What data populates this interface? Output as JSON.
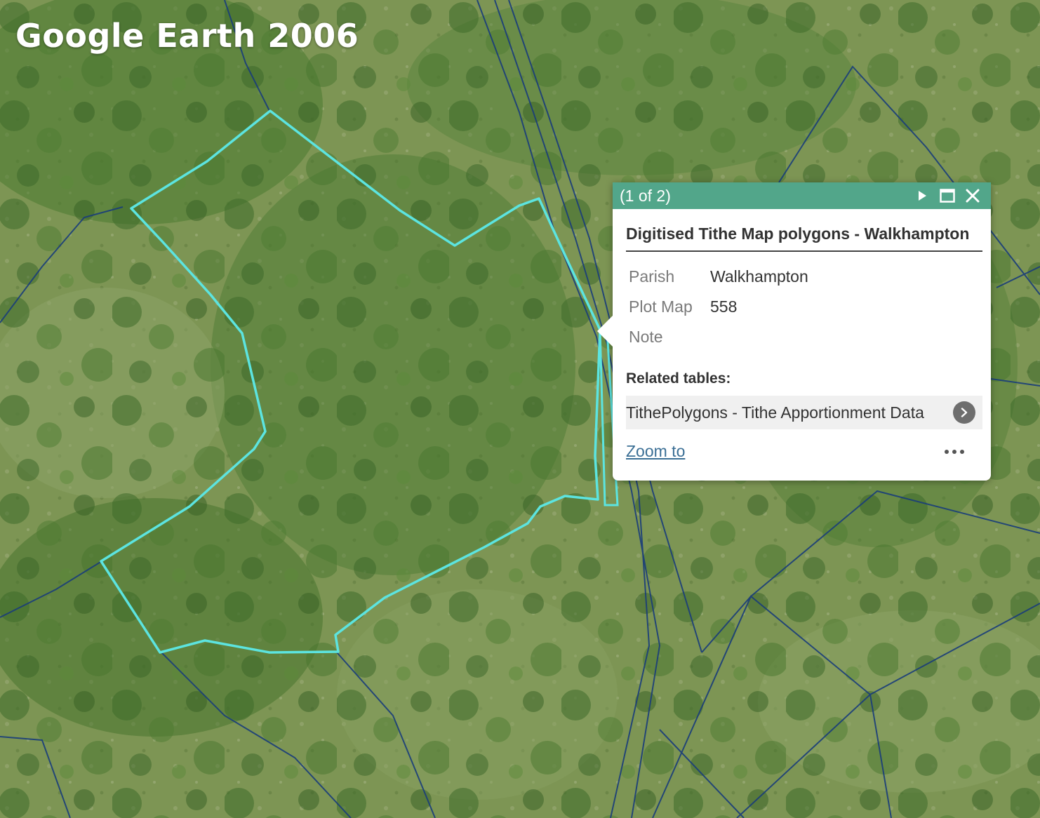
{
  "basemap": {
    "label": "Google Earth 2006"
  },
  "colors": {
    "highlight_outline": "#5ce4e0",
    "parcel_boundaries": "#1a3d7a",
    "popup_header": "#52a68a"
  },
  "popup": {
    "page_count": "(1 of 2)",
    "actions": [
      "next-icon",
      "maximize-icon",
      "close-icon"
    ],
    "title": "Digitised Tithe Map polygons - Walkhampton",
    "fields": [
      {
        "name": "Parish",
        "value": "Walkhampton"
      },
      {
        "name": "Plot Map",
        "value": "558"
      },
      {
        "name": "Note",
        "value": ""
      }
    ],
    "related_label": "Related tables:",
    "related_item": "TithePolygons - Tithe Apportionment Data",
    "zoom_label": "Zoom to"
  }
}
